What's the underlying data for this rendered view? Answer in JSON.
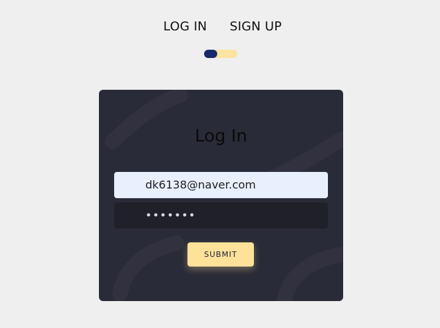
{
  "tabs": {
    "login_label": "LOG IN",
    "signup_label": "SIGN UP"
  },
  "toggle": {
    "state": "log-in",
    "active_color": "#17296a",
    "inactive_color": "#fbe3a0"
  },
  "card": {
    "title": "Log In",
    "email_value": "dk6138@naver.com",
    "password_mask": "•••••••",
    "submit_label": "SUBMIT",
    "background_color": "#2a2b38",
    "accent_color": "#ffe299"
  }
}
